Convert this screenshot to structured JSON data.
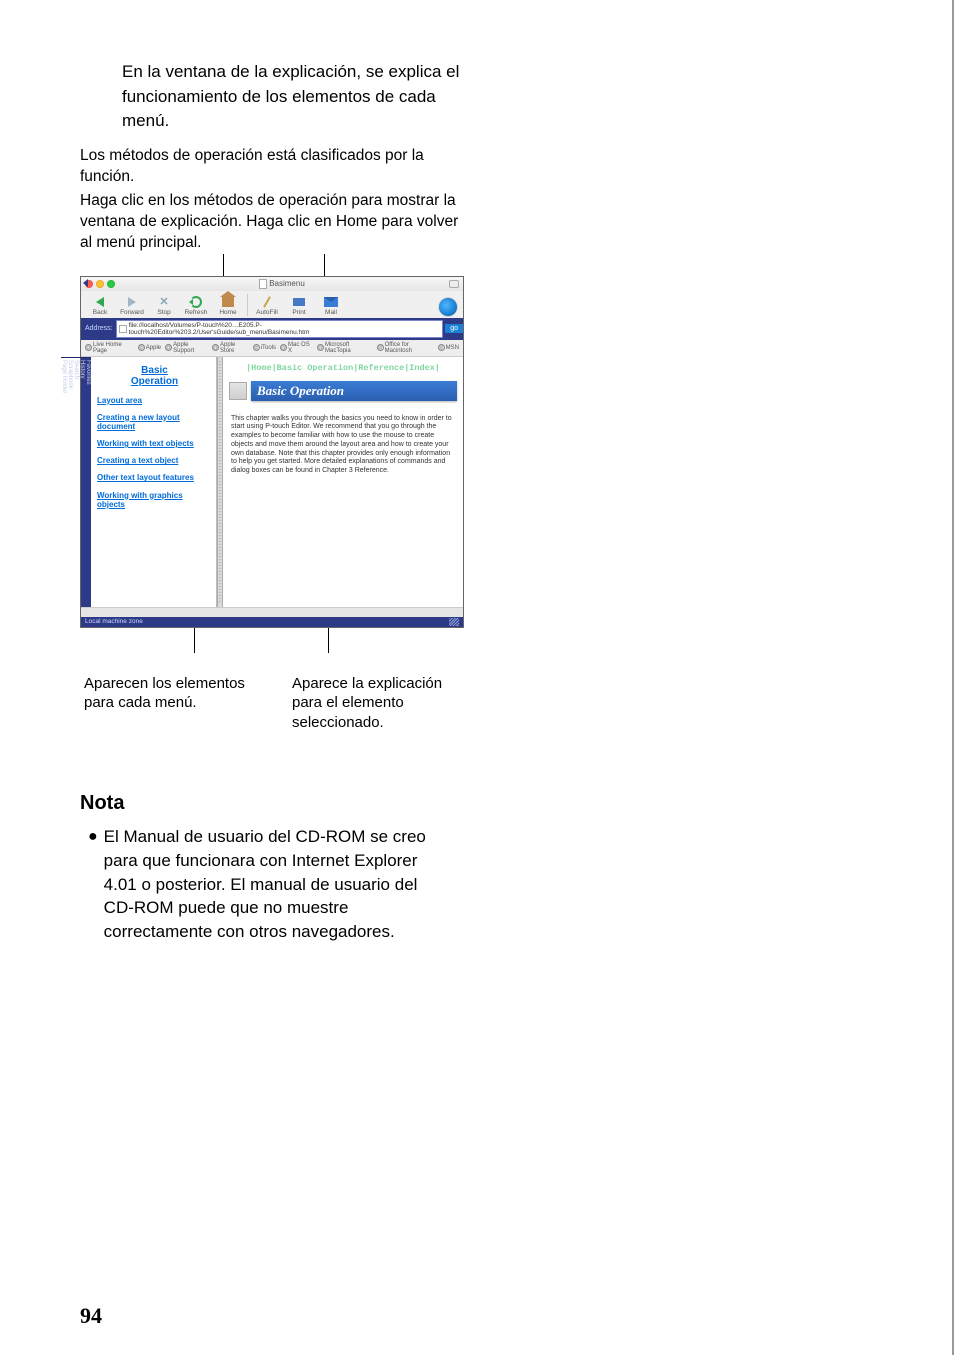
{
  "intro": {
    "bold": "En la ventana de la explicación, se explica el funcionamiento de los elementos de cada menú.",
    "p1": "Los métodos de operación está clasificados por la función.",
    "p2": "Haga clic en los métodos de operación para mostrar la ventana de explicación. Haga clic en Home para volver al menú principal."
  },
  "browser": {
    "title": "Basimenu",
    "toolbar": {
      "back": "Back",
      "forward": "Forward",
      "stop": "Stop",
      "refresh": "Refresh",
      "home": "Home",
      "autofill": "AutoFill",
      "print": "Print",
      "mail": "Mail"
    },
    "address": {
      "label": "Address:",
      "url": "file://localhost/Volumes/P-touch%20…E205.P-touch%20Editor%203.2/User'sGuide/sub_menu/Basimenu.htm",
      "go": "go"
    },
    "favorites": [
      "Live Home Page",
      "Apple",
      "Apple Support",
      "Apple Store",
      "iTools",
      "Mac OS X",
      "Microsoft MacTopia",
      "Office for Macintosh",
      "MSN"
    ],
    "sidetabs": [
      "Favorites",
      "History",
      "Search",
      "Scrapbook",
      "Page Holder"
    ],
    "leftPane": {
      "title1": "Basic",
      "title2": "Operation",
      "links": [
        "Layout area",
        "Creating a new layout document",
        "Working with text objects",
        "Creating a text object",
        "Other text layout features",
        "Working with graphics objects"
      ]
    },
    "topnav": "|Home|Basic Operation|Reference|Index|",
    "hero": "Basic Operation",
    "paragraph": "This chapter walks you through the basics you need to know in order to start using P-touch Editor. We recommend that you go through the examples to become familiar with how to use the mouse to create objects and move them around the layout area and how to create your own database. Note that this chapter provides only enough information to help you get started. More detailed explanations of commands and dialog boxes can be found in Chapter 3 Reference.",
    "status": "Local machine zone"
  },
  "captions": {
    "c1": "Aparecen los elementos para cada menú.",
    "c2": "Aparece la explicación para el elemento seleccionado."
  },
  "nota": {
    "heading": "Nota",
    "body": "El Manual de usuario del CD-ROM se creo para que funcionara con Internet Explorer 4.01 o posterior. El manual de usuario del CD-ROM puede que no muestre correctamente con otros navegadores."
  },
  "page": "94"
}
